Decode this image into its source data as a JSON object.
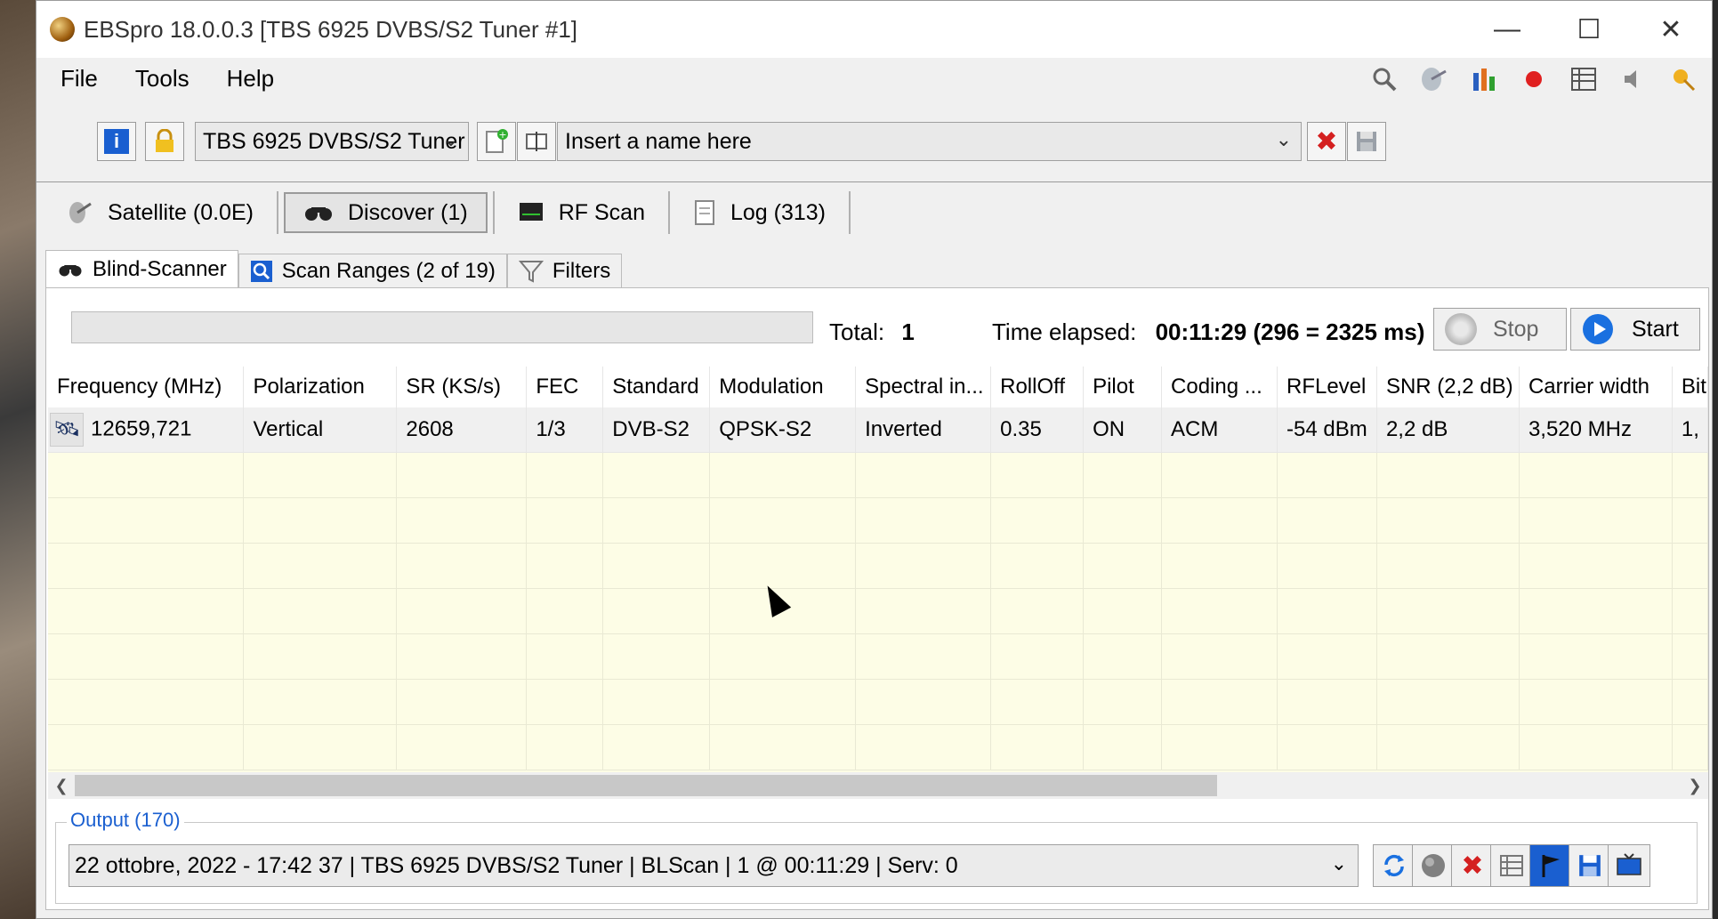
{
  "window": {
    "title": "EBSpro 18.0.0.3 [TBS 6925 DVBS/S2 Tuner #1]",
    "minimize": "—",
    "maximize": "☐",
    "close": "✕"
  },
  "menu": [
    "File",
    "Tools",
    "Help"
  ],
  "top_icons": [
    "search-icon",
    "satellite-dish-icon",
    "bar-chart-icon",
    "record-icon",
    "list-icon",
    "speaker-icon",
    "pin-icon"
  ],
  "toolbar": {
    "info_glyph": "i",
    "lock_glyph": "🔒",
    "tuner_select": "TBS 6925 DVBS/S2 Tuner",
    "name_placeholder": "Insert a name here",
    "delete_glyph": "✖",
    "save_glyph": "💾",
    "new_glyph": "+",
    "rename_glyph": "⇆"
  },
  "view_tabs": [
    {
      "label": "Satellite (0.0E)",
      "glyph": "✈"
    },
    {
      "label": "Discover (1)",
      "glyph": "🔭"
    },
    {
      "label": "RF Scan",
      "glyph": "▬"
    },
    {
      "label": "Log (313)",
      "glyph": "📄"
    }
  ],
  "sub_tabs": [
    {
      "label": "Blind-Scanner",
      "glyph": "🔭"
    },
    {
      "label": "Scan Ranges (2 of 19)",
      "glyph": "🔍"
    },
    {
      "label": "Filters",
      "glyph": "⏷"
    }
  ],
  "scanner": {
    "total_label": "Total:",
    "total_value": "1",
    "elapsed_label": "Time elapsed:",
    "elapsed_value": "00:11:29 (296 = 2325 ms)",
    "stop_label": "Stop",
    "start_label": "Start"
  },
  "grid": {
    "columns": [
      "Frequency (MHz)",
      "Polarization",
      "SR (KS/s)",
      "FEC",
      "Standard",
      "Modulation",
      "Spectral in...",
      "RollOff",
      "Pilot",
      "Coding ...",
      "RFLevel",
      "SNR (2,2 dB)",
      "Carrier width",
      "Bit"
    ],
    "rows": [
      [
        "12659,721",
        "Vertical",
        "2608",
        "1/3",
        "DVB-S2",
        "QPSK-S2",
        "Inverted",
        "0.35",
        "ON",
        "ACM",
        "-54 dBm",
        "2,2 dB",
        "3,520 MHz",
        "1,"
      ]
    ],
    "empty_rows": 7
  },
  "output": {
    "label": "Output (170)",
    "line": "22 ottobre, 2022 - 17:42 37 | TBS 6925 DVBS/S2 Tuner | BLScan | 1 @ 00:11:29 | Serv: 0"
  },
  "colors": {
    "accent_blue": "#1a5fd0",
    "grid_empty": "#fdfde6",
    "close_red": "#d42020"
  }
}
